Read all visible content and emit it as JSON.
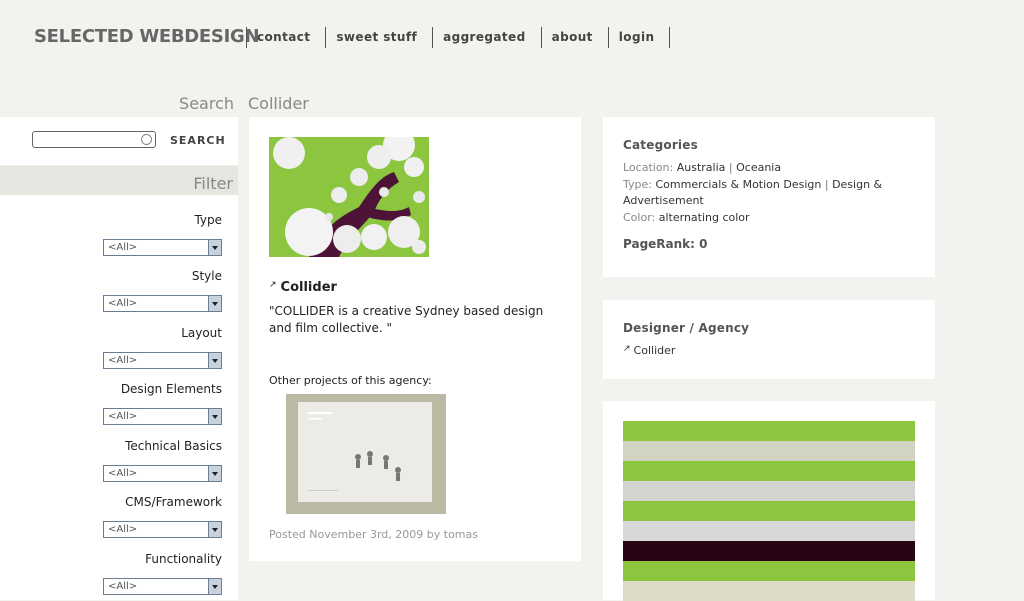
{
  "site": {
    "logo": "SELECTED WEBDESIGN",
    "nav": [
      "contact",
      "sweet stuff",
      "aggregated",
      "about",
      "login"
    ]
  },
  "search": {
    "heading": "Search",
    "button_label": "SEARCH",
    "value": ""
  },
  "page_title": "Collider",
  "filter": {
    "heading": "Filter",
    "items": [
      {
        "label": "Type",
        "value": "<All>"
      },
      {
        "label": "Style",
        "value": "<All>"
      },
      {
        "label": "Layout",
        "value": "<All>"
      },
      {
        "label": "Design Elements",
        "value": "<All>"
      },
      {
        "label": "Technical Basics",
        "value": "<All>"
      },
      {
        "label": "CMS/Framework",
        "value": "<All>"
      },
      {
        "label": "Functionality",
        "value": "<All>"
      }
    ]
  },
  "project": {
    "title": "Collider",
    "description": "\"COLLIDER is a creative Sydney based design and film collective. \"",
    "other_projects_label": "Other projects of this agency:",
    "posted": "Posted November 3rd, 2009 by tomas"
  },
  "categories": {
    "heading": "Categories",
    "location_key": "Location:",
    "location": [
      "Australia",
      "Oceania"
    ],
    "type_key": "Type:",
    "type_line1": "Commercials & Motion Design",
    "type_line1b": "Design &",
    "type_line2": "Advertisement",
    "color_key": "Color:",
    "color": "alternating color",
    "pagerank": "PageRank: 0"
  },
  "designer": {
    "heading": "Designer / Agency",
    "name": "Collider"
  },
  "colors": {
    "stripes": [
      "#8cc63f",
      "#d3d3c2",
      "#8cc63f",
      "#d3d3d0",
      "#8cc63f",
      "#d8d8d8",
      "#280515",
      "#8cc63f",
      "#dcdcc8"
    ]
  }
}
